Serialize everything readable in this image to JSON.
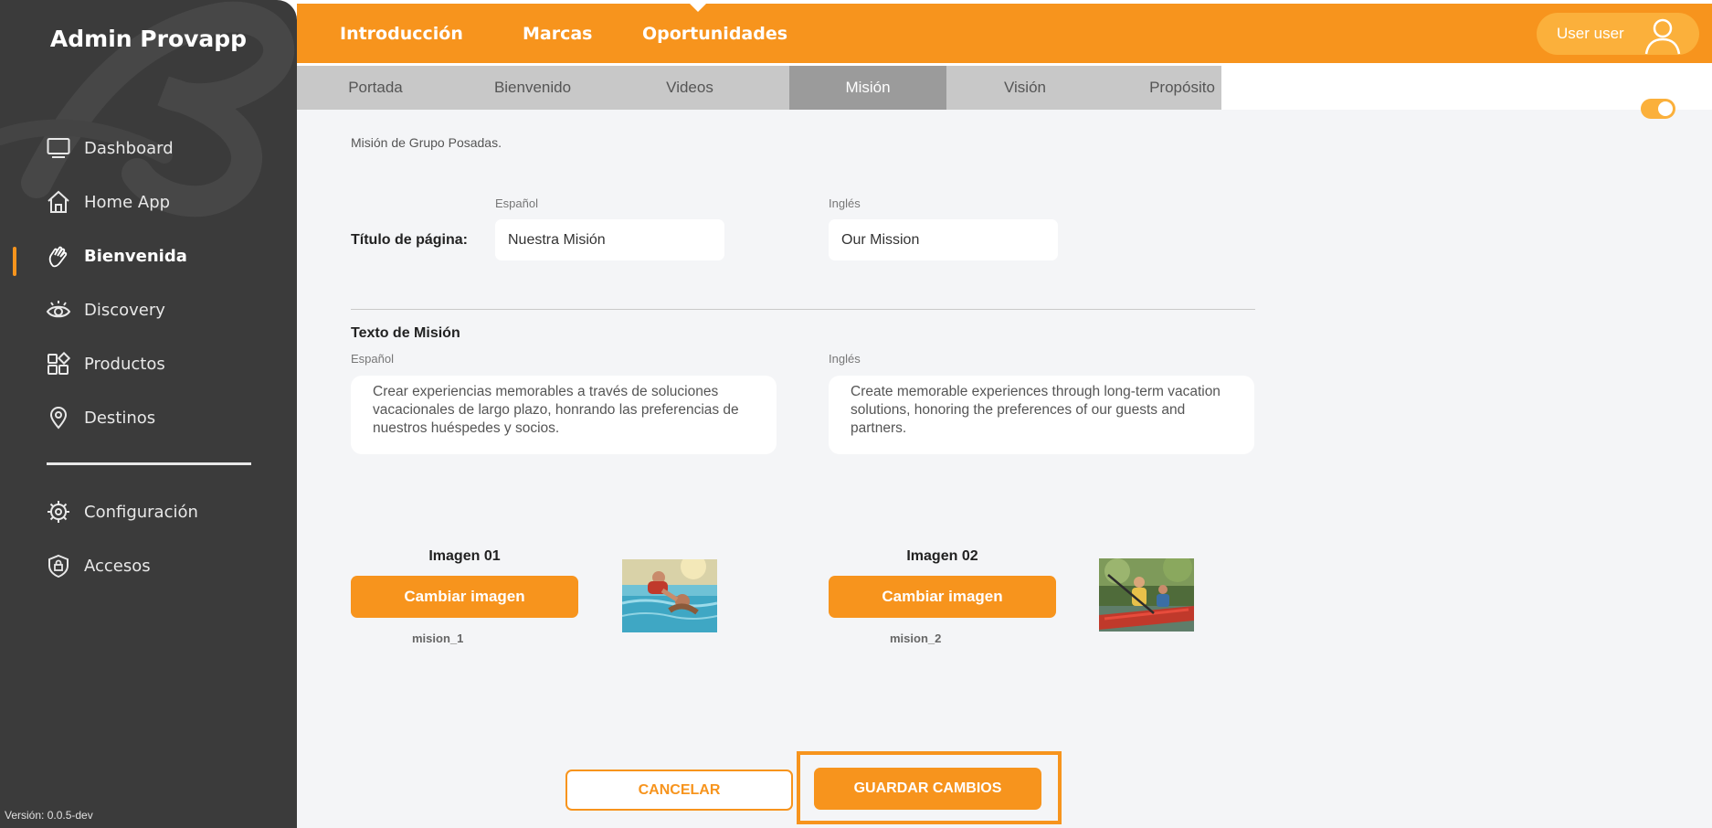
{
  "sidebar": {
    "brand": "Admin Provapp",
    "items": [
      {
        "label": "Dashboard",
        "icon": "monitor-icon"
      },
      {
        "label": "Home App",
        "icon": "home-icon"
      },
      {
        "label": "Bienvenida",
        "icon": "waving-hand-icon",
        "active": true
      },
      {
        "label": "Discovery",
        "icon": "eye-icon"
      },
      {
        "label": "Productos",
        "icon": "grid-icon"
      },
      {
        "label": "Destinos",
        "icon": "map-pin-icon"
      },
      {
        "label": "Configuración",
        "icon": "settings-icon"
      },
      {
        "label": "Accesos",
        "icon": "shield-lock-icon"
      }
    ],
    "version": "Versión: 0.0.5-dev"
  },
  "topnav": {
    "items": [
      "Introducción",
      "Marcas",
      "Oportunidades"
    ],
    "active": "Introducción",
    "user": "User user"
  },
  "subtabs": {
    "items": [
      "Portada",
      "Bienvenido",
      "Videos",
      "Misión",
      "Visión",
      "Propósito"
    ],
    "active": "Misión"
  },
  "main": {
    "subtitle": "Misión de Grupo Posadas.",
    "title_field": {
      "label": "Título de página:",
      "es_label": "Español",
      "en_label": "Inglés",
      "es_value": "Nuestra Misión",
      "en_value": "Our Mission"
    },
    "text_field": {
      "label": "Texto de Misión",
      "es_label": "Español",
      "en_label": "Inglés",
      "es_value": "Crear experiencias memorables a través de soluciones vacacionales de largo plazo, honrando las preferencias de nuestros huéspedes y socios.",
      "en_value": "Create memorable experiences through long-term vacation solutions, honoring the preferences of our guests and partners."
    },
    "images": [
      {
        "title": "Imagen 01",
        "button": "Cambiar imagen",
        "name": "mision_1"
      },
      {
        "title": "Imagen 02",
        "button": "Cambiar imagen",
        "name": "mision_2"
      }
    ],
    "cancel_label": "CANCELAR",
    "save_label": "GUARDAR CAMBIOS"
  },
  "colors": {
    "accent": "#f7941d",
    "sidebar": "#3b3b3b",
    "subtab_active": "#9b9b9b"
  }
}
